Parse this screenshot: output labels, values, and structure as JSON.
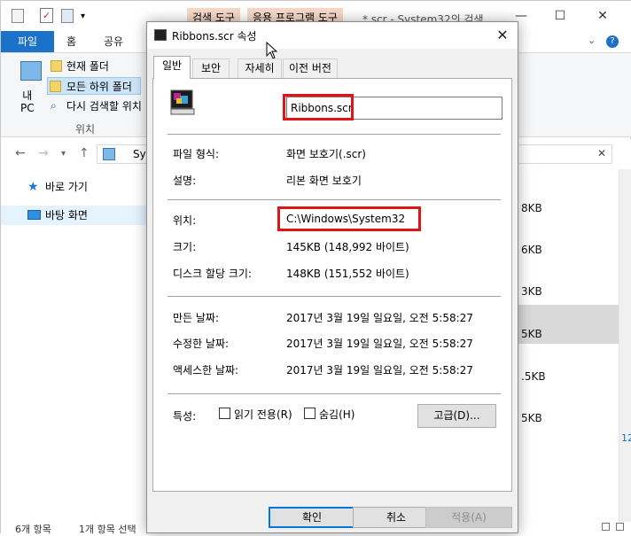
{
  "explorer": {
    "context_tab_search": "검색 도구",
    "context_tab_app": "응용 프로그램 도구",
    "window_title": "*.scr - System32의 검색 ...",
    "ribbon_tabs": {
      "file": "파일",
      "home": "홈",
      "share": "공유"
    },
    "ribbon": {
      "my_pc_label": "내\nPC",
      "current_folder": "현재 폴더",
      "all_subfolders": "모든 하위 폴더",
      "search_again": "다시 검색할 위치",
      "group_location": "위치"
    },
    "address_partial": "Sys",
    "nav_pane": {
      "quick_access": "바로 가기",
      "desktop": "바탕 화면"
    },
    "size_column": [
      "8KB",
      "6KB",
      "3KB",
      "5KB",
      ".5KB",
      "5KB"
    ],
    "status": {
      "items": "6개 항목",
      "selected": "1개 항목 선택"
    },
    "right_edge_text": "12",
    "colors": {
      "file_tab": "#1a73c9",
      "highlight": "#d9d9d9",
      "annotation_red": "#e01414"
    }
  },
  "dialog": {
    "title": "Ribbons.scr 속성",
    "tabs": [
      "일반",
      "보안",
      "자세히",
      "이전 버전"
    ],
    "file_name": "Ribbons.scr",
    "properties": [
      {
        "label": "파일 형식:",
        "value": "화면 보호기(.scr)"
      },
      {
        "label": "설명:",
        "value": "리본 화면 보호기"
      },
      {
        "label": "위치:",
        "value": "C:\\Windows\\System32"
      },
      {
        "label": "크기:",
        "value": "145KB (148,992 바이트)"
      },
      {
        "label": "디스크 할당 크기:",
        "value": "148KB (151,552 바이트)"
      },
      {
        "label": "만든 날짜:",
        "value": "2017년 3월 19일 일요일, 오전 5:58:27"
      },
      {
        "label": "수정한 날짜:",
        "value": "2017년 3월 19일 일요일, 오전 5:58:27"
      },
      {
        "label": "액세스한 날짜:",
        "value": "2017년 3월 19일 일요일, 오전 5:58:27"
      }
    ],
    "attributes_label": "특성:",
    "readonly_label": "읽기 전용(R)",
    "hidden_label": "숨김(H)",
    "advanced_button": "고급(D)...",
    "ok_button": "확인",
    "cancel_button": "취소",
    "apply_button": "적용(A)"
  }
}
